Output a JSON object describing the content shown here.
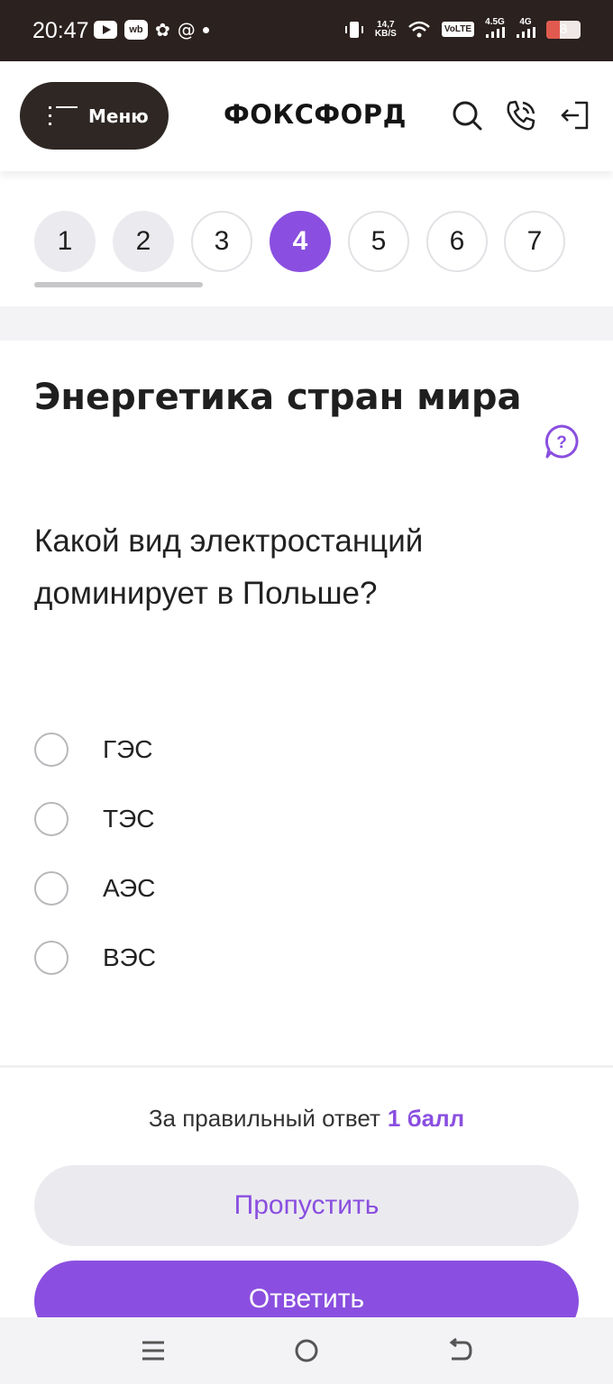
{
  "status_bar": {
    "time": "20:47",
    "wb_badge": "wb",
    "net_speed_top": "14,7",
    "net_speed_bottom": "KB/S",
    "volte": "VoLTE",
    "net_45g": "4.5G",
    "net_4g": "4G",
    "battery": "8",
    "battery_level": 0.08
  },
  "header": {
    "menu_label": "Меню",
    "brand": "ФОКСФОРД",
    "icons": [
      "search-icon",
      "phone-icon",
      "login-icon"
    ]
  },
  "tabs": [
    {
      "label": "1",
      "state": "done"
    },
    {
      "label": "2",
      "state": "done"
    },
    {
      "label": "3",
      "state": "default"
    },
    {
      "label": "4",
      "state": "active"
    },
    {
      "label": "5",
      "state": "default"
    },
    {
      "label": "6",
      "state": "default"
    },
    {
      "label": "7",
      "state": "default"
    }
  ],
  "task": {
    "title": "Энергетика стран мира",
    "question": "Какой вид электростанций доминирует в Польше?",
    "options": [
      "ГЭС",
      "ТЭС",
      "АЭС",
      "ВЭС"
    ]
  },
  "footer": {
    "score_label": "За правильный ответ",
    "score_value": "1 балл",
    "skip_label": "Пропустить",
    "answer_label": "Ответить"
  },
  "colors": {
    "accent": "#8a4fe0",
    "status_bar_bg": "#2b211e",
    "menu_button_bg": "#2e2723"
  }
}
